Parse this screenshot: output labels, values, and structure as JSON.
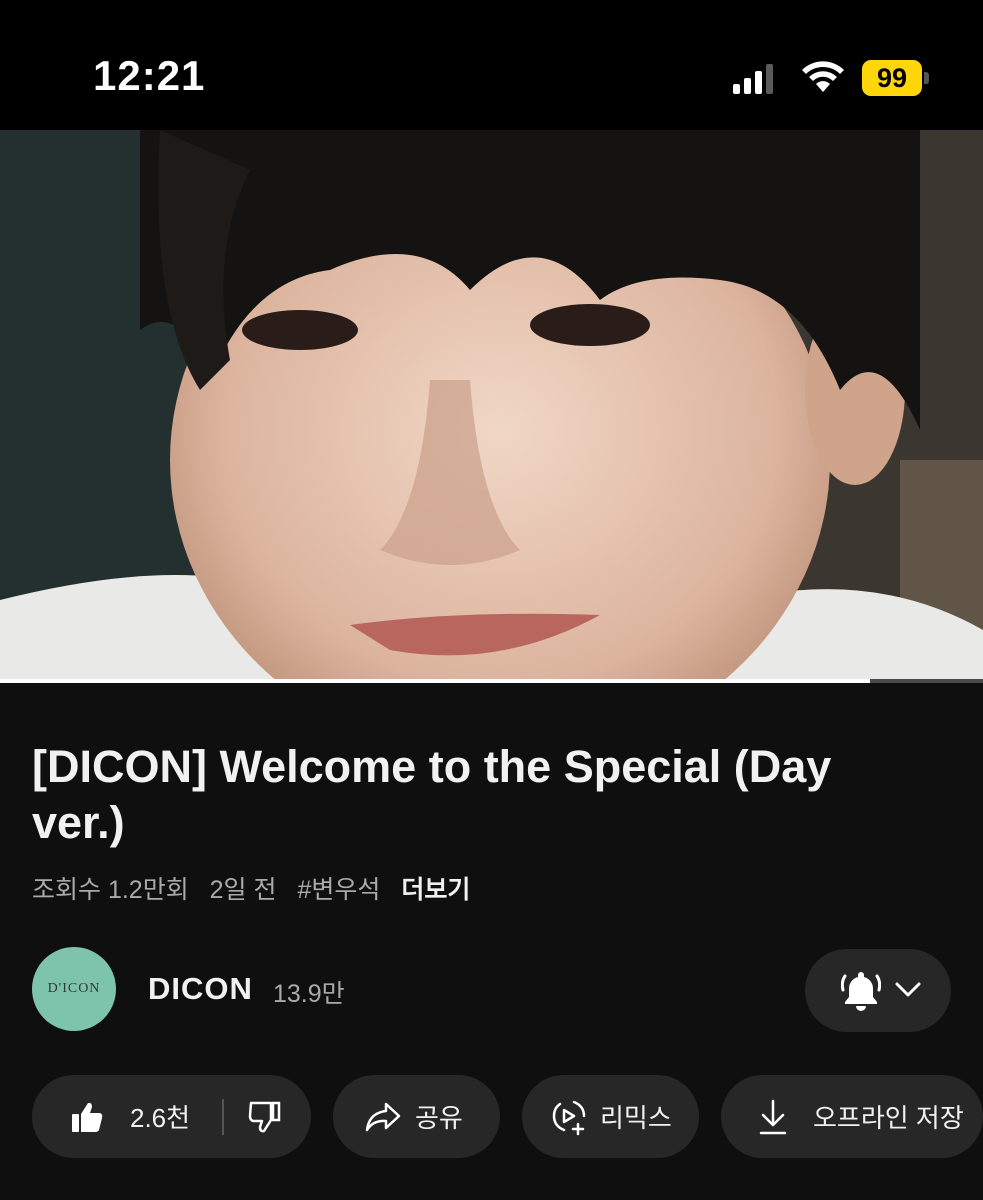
{
  "status_bar": {
    "time": "12:21",
    "battery_level": "99",
    "icons": [
      "cellular-signal-icon",
      "wifi-icon",
      "battery-icon"
    ]
  },
  "video": {
    "description_icon": "video-thumbnail",
    "progress_fraction": 0.885
  },
  "title": "[DICON] Welcome to the Special (Day ver.)",
  "meta": {
    "views": "조회수 1.2만회",
    "age": "2일 전",
    "hashtag": "#변우석",
    "more": "더보기"
  },
  "channel": {
    "avatar_text": "D'ICON",
    "name": "DICON",
    "subscribers": "13.9만"
  },
  "actions": {
    "like_count": "2.6천",
    "share": "공유",
    "remix": "리믹스",
    "offline": "오프라인 저장"
  },
  "colors": {
    "background": "#0f0f0f",
    "pill": "#272727",
    "battery": "#ffd60a",
    "avatar": "#7ec4ad"
  }
}
